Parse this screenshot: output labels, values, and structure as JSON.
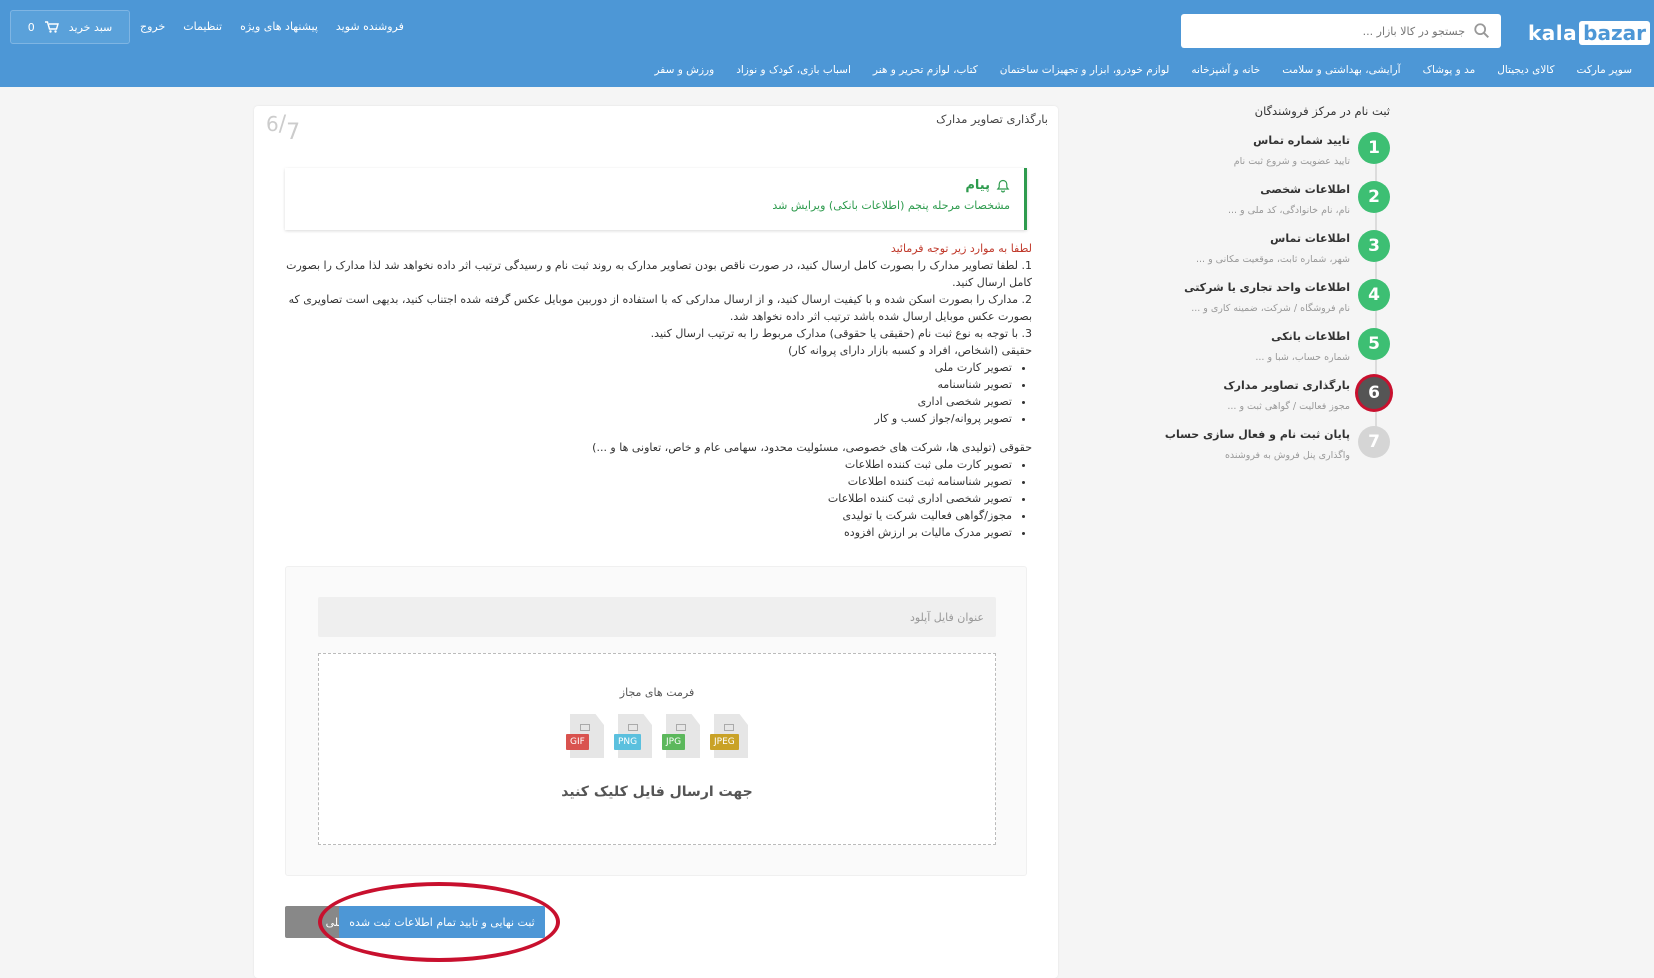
{
  "header": {
    "logo_kala": "kala",
    "logo_bazar": "bazar",
    "search_placeholder": "جستجو در کالا بازار ...",
    "links": [
      "فروشنده شوید",
      "پیشنهاد های ویژه",
      "تنظیمات",
      "خروج"
    ],
    "cart_label": "سبد خرید",
    "cart_count": "0",
    "brand_color": "#4d97d6"
  },
  "nav": [
    "سوپر مارکت",
    "کالای دیجیتال",
    "مد و پوشاک",
    "آرایشی، بهداشتی و سلامت",
    "خانه و آشپزخانه",
    "لوازم خودرو، ابزار و تجهیزات ساختمان",
    "کتاب، لوازم تحریر و هنر",
    "اسباب بازی، کودک و نوزاد",
    "ورزش و سفر"
  ],
  "sidebar": {
    "title": "ثبت نام در مرکز فروشندگان",
    "steps": [
      {
        "num": "1",
        "title": "تایید شماره تماس",
        "sub": "تایید عضویت و شروع ثبت نام",
        "status": "done",
        "color": "#3dbf73"
      },
      {
        "num": "2",
        "title": "اطلاعات شخصی",
        "sub": "نام، نام خانوادگی، کد ملی و ...",
        "status": "done",
        "color": "#3dbf73"
      },
      {
        "num": "3",
        "title": "اطلاعات تماس",
        "sub": "شهر، شماره ثابت، موقعیت مکانی و ...",
        "status": "done",
        "color": "#3dbf73"
      },
      {
        "num": "4",
        "title": "اطلاعات واحد تجاری یا شرکتی",
        "sub": "نام فروشگاه / شرکت، ضمینه کاری و ...",
        "status": "done",
        "color": "#3dbf73"
      },
      {
        "num": "5",
        "title": "اطلاعات بانکی",
        "sub": "شماره حساب، شبا و ...",
        "status": "done",
        "color": "#3dbf73"
      },
      {
        "num": "6",
        "title": "بارگذاری تصاویر مدارک",
        "sub": "مجوز فعالیت / گواهی ثبت و ...",
        "status": "current",
        "color": "#555555"
      },
      {
        "num": "7",
        "title": "پایان ثبت نام و فعال سازی حساب",
        "sub": "واگذاری پنل فروش به فروشنده",
        "status": "todo",
        "color": "#d5d5d5"
      }
    ]
  },
  "card": {
    "title": "بارگذاری تصاویر مدارک",
    "step_current": "6",
    "step_total": "7",
    "message": {
      "title": "پیام",
      "body": "مشخصات مرحله پنجم (اطلاعات بانکی) ویرایش شد"
    },
    "notes": {
      "warning": "لطفا به موارد زیر توجه فرمائید",
      "items": [
        "1. لطفا تصاویر مدارک را بصورت کامل ارسال کنید، در صورت ناقص بودن تصاویر مدارک به روند ثبت نام و رسیدگی ترتیب اثر داده نخواهد شد لذا مدارک را بصورت کامل ارسال کنید.",
        "2. مدارک را بصورت اسکن شده و با کیفیت ارسال کنید، و از ارسال مدارکی که با استفاده از دوربین موبایل عکس گرفته شده اجتناب کنید، بدیهی است تصاویری که بصورت عکس موبایل ارسال شده باشد ترتیب اثر داده نخواهد شد.",
        "3. با توجه به نوع ثبت نام (حقیقی یا حقوقی) مدارک مربوط را به ترتیب ارسال کنید."
      ],
      "real_title": "حقیقی (اشخاص، افراد و کسبه بازار دارای پروانه کار)",
      "real_docs": [
        "تصویر کارت ملی",
        "تصویر شناسنامه",
        "تصویر شخصی اداری",
        "تصویر پروانه/جواز کسب و کار"
      ],
      "legal_title": "حقوقی (تولیدی ها، شرکت های خصوصی، مسئولیت محدود، سهامی عام و خاص، تعاونی ها و ...)",
      "legal_docs": [
        "تصویر کارت ملی ثبت کننده اطلاعات",
        "تصویر شناسنامه ثبت کننده اطلاعات",
        "تصویر شخصی اداری ثبت کننده اطلاعات",
        "مجوز/گواهی فعالیت شرکت یا تولیدی",
        "تصویر مدرک مالیات بر ارزش افزوده"
      ]
    },
    "upload": {
      "title_placeholder": "عنوان فایل آپلود",
      "formats_label": "فرمت های مجاز",
      "formats": [
        {
          "name": "GIF",
          "color": "#d9534f"
        },
        {
          "name": "PNG",
          "color": "#5bc0de"
        },
        {
          "name": "JPG",
          "color": "#5cb85c"
        },
        {
          "name": "JPEG",
          "color": "#c9a227"
        }
      ],
      "cta": "جهت ارسال فایل کلیک کنید"
    },
    "buttons": {
      "prev": "قبلی",
      "final": "ثبت نهایی و تایید تمام اطلاعات ثبت شده"
    }
  }
}
